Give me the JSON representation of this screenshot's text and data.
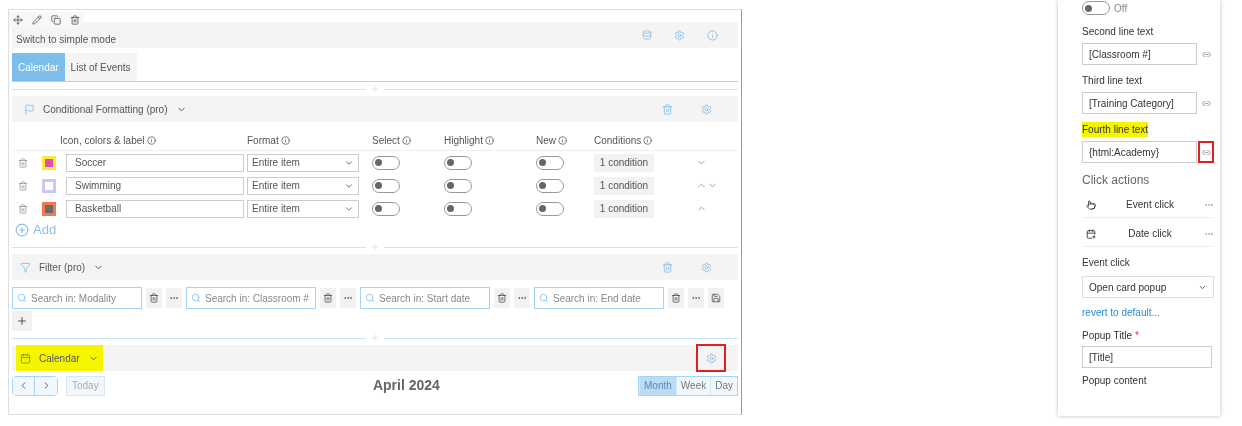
{
  "editor": {
    "mode_link": "Switch to simple mode",
    "tabs": [
      {
        "label": "Calendar",
        "selected": true
      },
      {
        "label": "List of Events",
        "selected": false
      }
    ],
    "conditional_formatting": {
      "title": "Conditional Formatting (pro)",
      "columns": [
        "Icon, colors & label",
        "Format",
        "Select",
        "Highlight",
        "New",
        "Conditions"
      ],
      "rows": [
        {
          "label": "Soccer",
          "color": "#f7ea3c",
          "inner": {
            "color": "#e04fb0"
          },
          "format": "Entire item",
          "select": false,
          "highlight": false,
          "new": false,
          "conditions": "1 condition",
          "up": false,
          "down": true
        },
        {
          "label": "Swimming",
          "color": "#cfc4f5",
          "inner": {
            "color": "#ffffff"
          },
          "format": "Entire item",
          "select": false,
          "highlight": false,
          "new": false,
          "conditions": "1 condition",
          "up": true,
          "down": true
        },
        {
          "label": "Basketball",
          "color": "#ee7a4e",
          "inner": {
            "color": "#6b6b6b"
          },
          "format": "Entire item",
          "select": false,
          "highlight": false,
          "new": false,
          "conditions": "1 condition",
          "up": true,
          "down": false
        }
      ],
      "add": "Add"
    },
    "filter": {
      "title": "Filter (pro)",
      "fields": [
        {
          "placeholder": "Search in: Modality"
        },
        {
          "placeholder": "Search in: Classroom #"
        },
        {
          "placeholder": "Search in: Start date"
        },
        {
          "placeholder": "Search in: End date"
        }
      ]
    },
    "calendar": {
      "title": "Calendar",
      "highlighted": true,
      "gear_outlined": true,
      "today": "Today",
      "month_title": "April 2024",
      "views": [
        {
          "label": "Month",
          "selected": true
        },
        {
          "label": "Week",
          "selected": false
        },
        {
          "label": "Day",
          "selected": false
        }
      ]
    }
  },
  "settings": {
    "toggle": {
      "on": false,
      "label": "Off"
    },
    "lines": [
      {
        "label": "Second line text",
        "value": "[Classroom #]",
        "highlighted": false,
        "outlined": false
      },
      {
        "label": "Third line text",
        "value": "[Training Category]",
        "highlighted": false,
        "outlined": false
      },
      {
        "label": "Fourth line text",
        "value": "{html:Academy}",
        "highlighted": true,
        "outlined": true
      }
    ],
    "click_actions_title": "Click actions",
    "actions": [
      {
        "kind": "event",
        "label": "Event click"
      },
      {
        "kind": "date",
        "label": "Date click"
      }
    ],
    "event_click_label": "Event click",
    "event_click_value": "Open card popup",
    "revert": "revert to default...",
    "popup_title_label": "Popup Title",
    "required_mark": "*",
    "popup_title_value": "[Title]",
    "popup_content_label": "Popup content"
  }
}
